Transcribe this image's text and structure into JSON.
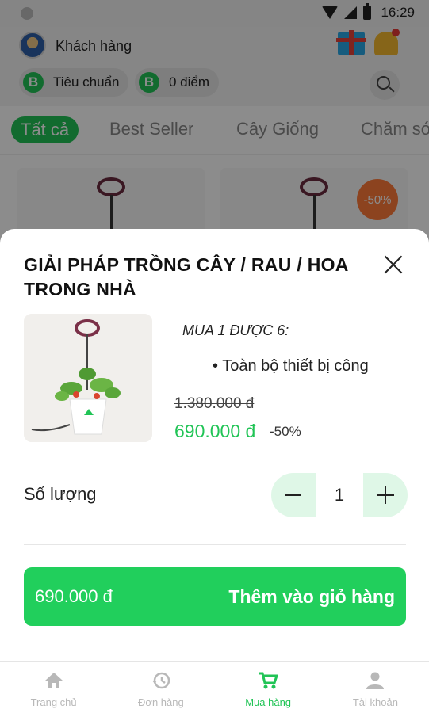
{
  "status_bar": {
    "time": "16:29"
  },
  "header": {
    "user_name": "Khách hàng",
    "tier_badge": "B",
    "tier_label": "Tiêu chuẩn",
    "points_badge": "B",
    "points_label": "0 điểm"
  },
  "tabs": [
    "Tất cả",
    "Best Seller",
    "Cây Giống",
    "Chăm sóc"
  ],
  "card_badge": "-50%",
  "sheet": {
    "title": "GIẢI PHÁP TRỒNG CÂY / RAU / HOA TRONG NHÀ",
    "promo_text": "MUA 1 ĐƯỢC 6:",
    "bullet_text": "• Toàn bộ thiết bị công",
    "old_price": "1.380.000 đ",
    "new_price": "690.000 đ",
    "discount": "-50%",
    "quantity_label": "Số lượng",
    "quantity_value": "1",
    "cta_price": "690.000 đ",
    "cta_label": "Thêm vào giỏ hàng"
  },
  "bottom_nav": [
    {
      "label": "Trang chủ",
      "icon": "home-icon"
    },
    {
      "label": "Đơn hàng",
      "icon": "history-icon"
    },
    {
      "label": "Mua hàng",
      "icon": "cart-icon"
    },
    {
      "label": "Tài khoản",
      "icon": "person-icon"
    }
  ],
  "colors": {
    "accent": "#21c456",
    "cta": "#21cf5c",
    "discount_badge": "#ff7a3a"
  }
}
